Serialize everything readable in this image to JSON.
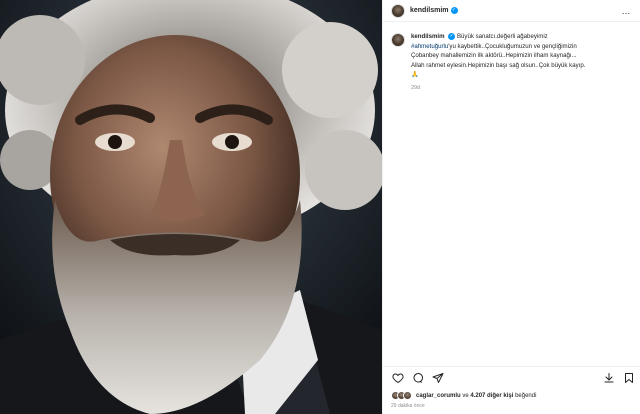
{
  "post": {
    "username": "kendilsmim",
    "more_icon": "…",
    "caption": {
      "username": "kendilsmim",
      "line1": "Büyük sanatcı.değerli ağabeyimiz",
      "hashtag": "#ahmetuğurlu",
      "line2_rest": "'yu kaybettik..Çocukluğumuzun ve gençliğimizin",
      "line3": "Çobanbey mahallemizin ilk aktörü..Hepimizin ilham kaynağı...",
      "line4": "Allah rahmet eylesin.Hepimizin başı sağ olsun..Çok büyük kayıp.",
      "emoji": "🙏",
      "time": "29d"
    },
    "likes": {
      "user": "caglar_corumlu",
      "connector": "ve",
      "count_text": "4.207 diğer kişi",
      "suffix": "beğendi"
    },
    "posted_ago": "29 dakika önce"
  },
  "icons": {
    "heart": "heart-icon",
    "comment": "comment-icon",
    "share": "share-icon",
    "save": "bookmark-icon",
    "download": "download-icon"
  }
}
